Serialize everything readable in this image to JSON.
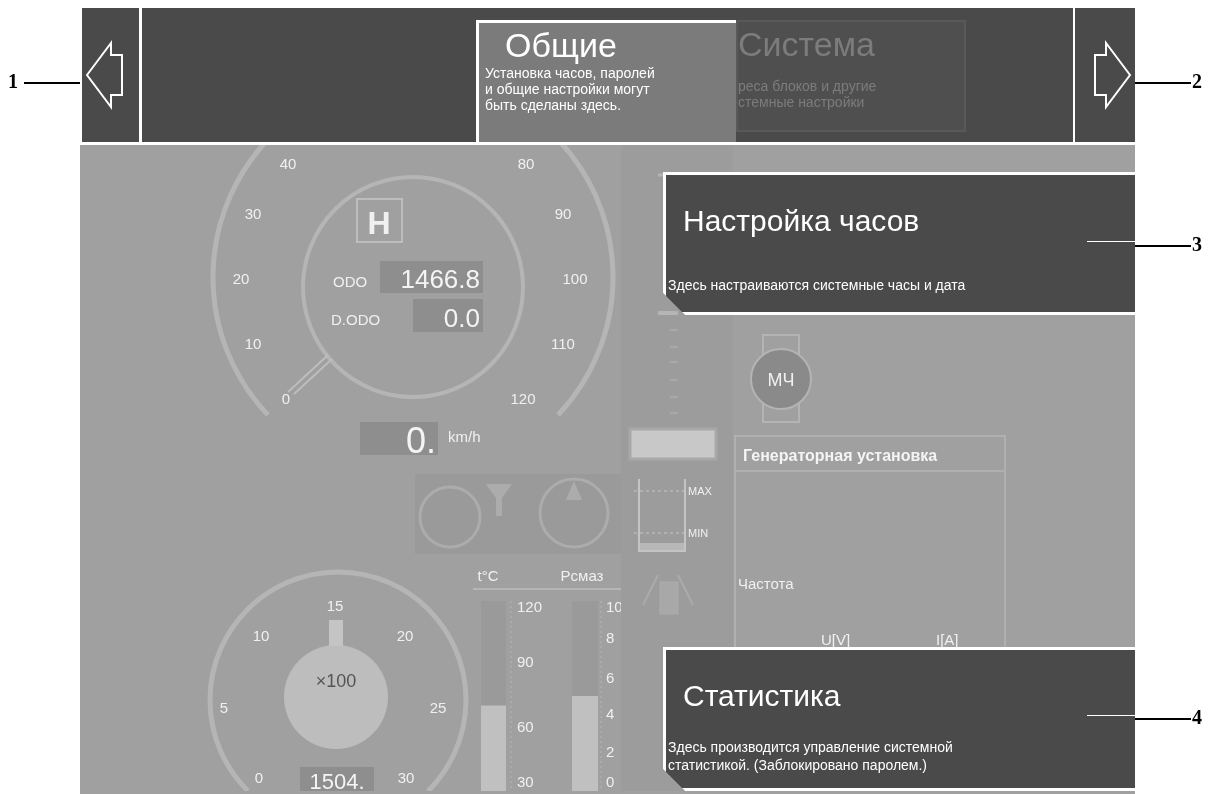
{
  "callouts": [
    "1",
    "2",
    "3",
    "4"
  ],
  "top_bar": {
    "tabs": [
      {
        "title": "Общие",
        "lines": [
          "Установка часов, паролей",
          "и общие настройки могут",
          "быть сделаны здесь."
        ],
        "selected": true
      },
      {
        "title": "Система",
        "lines": [
          "реса блоков и другие",
          "стемные настройки"
        ],
        "selected": false
      }
    ]
  },
  "speedometer": {
    "scale": [
      "40",
      "30",
      "20",
      "10",
      "0",
      "80",
      "90",
      "100",
      "110",
      "120"
    ],
    "gear": "H",
    "odo_label": "ODO",
    "odo": "1466.8",
    "dodo_label": "D.ODO",
    "dodo": "0.0",
    "speed": "0.",
    "unit": "km/h"
  },
  "tachometer": {
    "scale": [
      "0",
      "5",
      "10",
      "15",
      "20",
      "25",
      "30"
    ],
    "multiplier": "×100",
    "hours": "1504."
  },
  "temperature": {
    "label": "t°C",
    "scale": [
      "120",
      "90",
      "60",
      "30"
    ],
    "level": 0.45
  },
  "oil_pressure": {
    "label": "Рсмаз",
    "scale": [
      "10",
      "8",
      "6",
      "4",
      "2",
      "0"
    ],
    "level": 0.5
  },
  "tank": {
    "max": "MAX",
    "min": "MIN"
  },
  "hour_meter": {
    "label": "МЧ"
  },
  "generator": {
    "title": "Генераторная установка",
    "frequency": "Частота",
    "voltage": "U[V]",
    "current": "I[A]"
  },
  "overlays": [
    {
      "title": "Настройка часов",
      "lines": [
        "Здесь настраиваются системные часы и дата"
      ]
    },
    {
      "title": "Статистика",
      "lines": [
        "Здесь производится управление системной",
        "статистикой. (Заблокировано паролем.)"
      ]
    }
  ]
}
